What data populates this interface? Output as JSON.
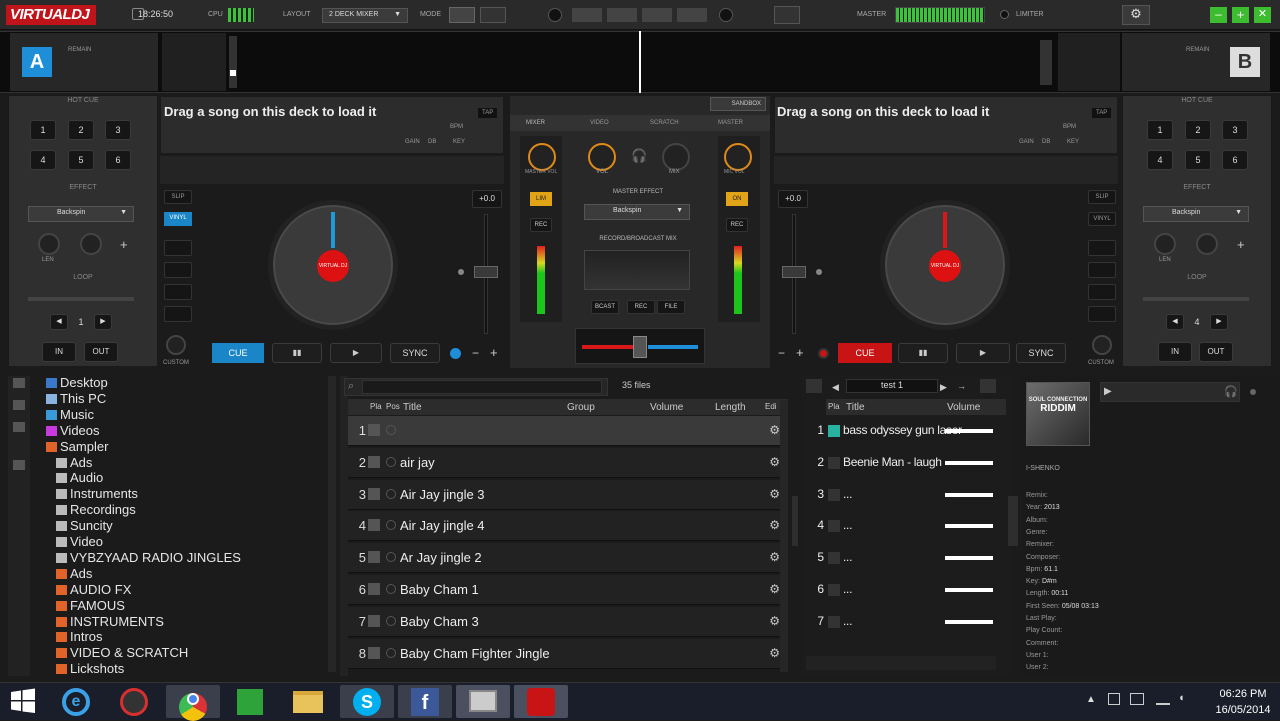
{
  "topbar": {
    "logo": "VIRTUALDJ",
    "time": "18:26:50",
    "cpu_label": "CPU",
    "layout_label": "LAYOUT",
    "layout_value": "2 DECK MIXER",
    "mode_label": "MODE",
    "master_label": "MASTER",
    "limiter_label": "LIMITER"
  },
  "deckA": {
    "letter": "A",
    "remain": "REMAIN",
    "hotcue": "HOT CUE",
    "pads": [
      "1",
      "2",
      "3",
      "4",
      "5",
      "6"
    ],
    "effect": "EFFECT",
    "effect_value": "Backspin",
    "len": "LEN",
    "loop": "LOOP",
    "loop_value": "1",
    "in": "IN",
    "out": "OUT",
    "song": "Drag a song on this deck to load it",
    "tap": "TAP",
    "bpm": "BPM",
    "gain": "GAIN",
    "db": "dB",
    "key": "KEY",
    "slip": "SLIP",
    "vinyl": "VINYL",
    "custom": "CUSTOM",
    "pitch": "+0.0",
    "cue": "CUE",
    "sync": "SYNC",
    "platter_label": "VIRTUAL DJ"
  },
  "deckB": {
    "letter": "B",
    "remain": "REMAIN",
    "hotcue": "HOT CUE",
    "pads": [
      "1",
      "2",
      "3",
      "4",
      "5",
      "6"
    ],
    "effect": "EFFECT",
    "effect_value": "Backspin",
    "len": "LEN",
    "loop": "LOOP",
    "loop_value": "4",
    "in": "IN",
    "out": "OUT",
    "song": "Drag a song on this deck to load it",
    "tap": "TAP",
    "bpm": "BPM",
    "gain": "GAIN",
    "db": "dB",
    "key": "KEY",
    "slip": "SLIP",
    "vinyl": "VINYL",
    "custom": "CUSTOM",
    "pitch": "+0.0",
    "cue": "CUE",
    "sync": "SYNC",
    "platter_label": "VIRTUAL DJ"
  },
  "mixer": {
    "sandbox": "SANDBOX",
    "tabs": [
      "MIXER",
      "VIDEO",
      "SCRATCH",
      "MASTER"
    ],
    "master_vol": "MASTER VOL",
    "vol": "VOL",
    "mix": "MIX",
    "mic_vol": "MIC VOL",
    "lim": "LIM",
    "on": "ON",
    "rec": "REC",
    "master_effect": "MASTER EFFECT",
    "master_effect_value": "Backspin",
    "record_broadcast": "RECORD/BROADCAST MIX",
    "bcast": "BCAST",
    "rec2": "REC",
    "file": "FILE"
  },
  "folders": {
    "items": [
      {
        "label": "Desktop",
        "icon": "desktop-icon",
        "color": "#3a79c9"
      },
      {
        "label": "This PC",
        "icon": "pc-icon",
        "color": "#8ab4e0"
      },
      {
        "label": "Music",
        "icon": "music-icon",
        "color": "#3a9ad9"
      },
      {
        "label": "Videos",
        "icon": "videos-icon",
        "color": "#c83adf"
      },
      {
        "label": "Sampler",
        "icon": "sampler-icon",
        "color": "#e0642a"
      },
      {
        "label": "Ads",
        "icon": "folder-icon",
        "color": "#bbbbbb"
      },
      {
        "label": "Audio",
        "icon": "folder-icon",
        "color": "#bbbbbb"
      },
      {
        "label": "Instruments",
        "icon": "folder-icon",
        "color": "#bbbbbb"
      },
      {
        "label": "Recordings",
        "icon": "folder-icon",
        "color": "#bbbbbb"
      },
      {
        "label": "Suncity",
        "icon": "folder-icon",
        "color": "#bbbbbb"
      },
      {
        "label": "Video",
        "icon": "folder-icon",
        "color": "#bbbbbb"
      },
      {
        "label": "VYBZYAAD RADIO JINGLES",
        "icon": "folder-icon",
        "color": "#bbbbbb"
      },
      {
        "label": "Ads",
        "icon": "folder-icon",
        "color": "#e0642a"
      },
      {
        "label": "AUDIO FX",
        "icon": "folder-icon",
        "color": "#e0642a"
      },
      {
        "label": "FAMOUS",
        "icon": "folder-icon",
        "color": "#e0642a"
      },
      {
        "label": "INSTRUMENTS",
        "icon": "folder-icon",
        "color": "#e0642a"
      },
      {
        "label": "Intros",
        "icon": "folder-icon",
        "color": "#e0642a"
      },
      {
        "label": "VIDEO & SCRATCH",
        "icon": "folder-icon",
        "color": "#e0642a"
      },
      {
        "label": "Lickshots",
        "icon": "folder-icon",
        "color": "#e0642a"
      }
    ]
  },
  "filelist": {
    "search_placeholder": "",
    "count": "35 files",
    "cols": [
      "Pla",
      "Pos",
      "Title",
      "Group",
      "Volume",
      "Length",
      "Edi"
    ],
    "rows": [
      {
        "n": "1",
        "title": ""
      },
      {
        "n": "2",
        "title": "air jay"
      },
      {
        "n": "3",
        "title": "Air Jay jingle 3"
      },
      {
        "n": "4",
        "title": "Air Jay jingle 4"
      },
      {
        "n": "5",
        "title": "Ar Jay jingle 2"
      },
      {
        "n": "6",
        "title": "Baby Cham 1"
      },
      {
        "n": "7",
        "title": "Baby Cham 3"
      },
      {
        "n": "8",
        "title": "Baby Cham Fighter Jingle"
      }
    ],
    "folders_tab": "folders",
    "sampler_tab": "sampler"
  },
  "sampler": {
    "name": "test 1",
    "cols": [
      "Pla",
      "Title",
      "Volume"
    ],
    "rows": [
      {
        "n": "1",
        "title": "bass odyssey gun laser"
      },
      {
        "n": "2",
        "title": "Beenie Man - laugh"
      },
      {
        "n": "3",
        "title": "..."
      },
      {
        "n": "4",
        "title": "..."
      },
      {
        "n": "5",
        "title": "..."
      },
      {
        "n": "6",
        "title": "..."
      },
      {
        "n": "7",
        "title": "..."
      }
    ],
    "info_tab": "info"
  },
  "info": {
    "cover_line1": "SOUL CONNECTION",
    "cover_line2": "RIDDIM",
    "artist": "I-SHENKO",
    "fields": [
      {
        "k": "Remix:",
        "v": ""
      },
      {
        "k": "Year:",
        "v": "2013"
      },
      {
        "k": "Album:",
        "v": ""
      },
      {
        "k": "Genre:",
        "v": ""
      },
      {
        "k": "Remixer:",
        "v": ""
      },
      {
        "k": "Composer:",
        "v": ""
      },
      {
        "k": "Bpm:",
        "v": "61.1"
      },
      {
        "k": "Key:",
        "v": "D#m"
      },
      {
        "k": "Length:",
        "v": "00:11"
      },
      {
        "k": "First Seen:",
        "v": "05/08 03:13"
      },
      {
        "k": "Last Play:",
        "v": ""
      },
      {
        "k": "Play Count:",
        "v": ""
      },
      {
        "k": "Comment:",
        "v": ""
      },
      {
        "k": "User 1:",
        "v": ""
      },
      {
        "k": "User 2:",
        "v": ""
      }
    ]
  },
  "taskbar": {
    "time": "06:26 PM",
    "date": "16/05/2014"
  }
}
